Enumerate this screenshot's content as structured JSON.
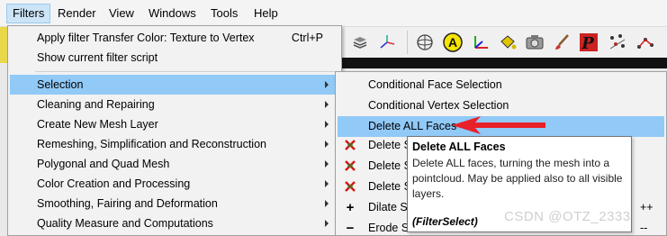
{
  "menubar": {
    "items": [
      {
        "label": "Filters"
      },
      {
        "label": "Render"
      },
      {
        "label": "View"
      },
      {
        "label": "Windows"
      },
      {
        "label": "Tools"
      },
      {
        "label": "Help"
      }
    ]
  },
  "filters_menu": {
    "top_items": [
      {
        "label": "Apply filter Transfer Color: Texture to Vertex",
        "shortcut": "Ctrl+P"
      },
      {
        "label": "Show current filter script",
        "shortcut": ""
      }
    ],
    "categories": [
      {
        "label": "Selection"
      },
      {
        "label": "Cleaning and Repairing"
      },
      {
        "label": "Create New Mesh Layer"
      },
      {
        "label": "Remeshing, Simplification and Reconstruction"
      },
      {
        "label": "Polygonal and Quad Mesh"
      },
      {
        "label": "Color Creation and Processing"
      },
      {
        "label": "Smoothing, Fairing and Deformation"
      },
      {
        "label": "Quality Measure and Computations"
      }
    ]
  },
  "selection_submenu": {
    "items": [
      {
        "label": "Conditional Face Selection",
        "icon": "",
        "trail": ""
      },
      {
        "label": "Conditional Vertex Selection",
        "icon": "",
        "trail": ""
      },
      {
        "label": "Delete ALL Faces",
        "icon": "",
        "trail": ""
      },
      {
        "label": "Delete S",
        "icon": "delete-cross-icon",
        "trail": ""
      },
      {
        "label": "Delete S",
        "icon": "delete-cross-icon",
        "trail": ""
      },
      {
        "label": "Delete S",
        "icon": "delete-cross-icon",
        "trail": ""
      },
      {
        "label": "Dilate S",
        "icon": "plus-icon",
        "trail": "++"
      },
      {
        "label": "Erode S",
        "icon": "minus-icon",
        "trail": "--"
      }
    ]
  },
  "tooltip": {
    "title": "Delete ALL Faces",
    "body": "Delete ALL faces, turning the mesh into a pointcloud. May be applied also to all visible layers.",
    "footer": "(FilterSelect)"
  },
  "toolbar": {
    "icons": [
      "layers-icon",
      "axes-icon",
      "sphere-icon",
      "annotation-a-icon",
      "axis-frame-icon",
      "paint-bucket-icon",
      "camera-icon",
      "brush-icon",
      "pick-p-icon",
      "points-select-icon",
      "points-connect-icon"
    ]
  },
  "watermark": "CSDN @OTZ_2333",
  "colors": {
    "highlight": "#91c9f7",
    "menubar_active": "#cce4f7",
    "arrow_red": "#e8202a"
  }
}
